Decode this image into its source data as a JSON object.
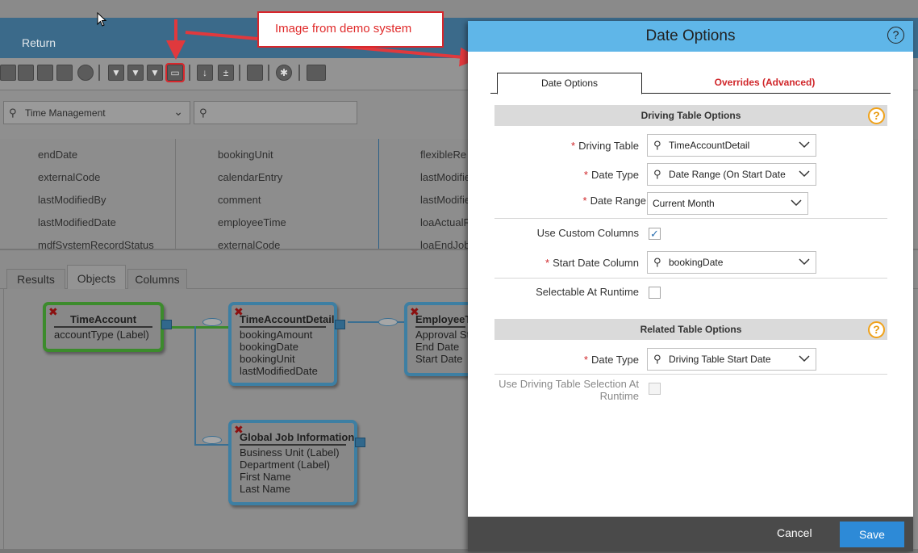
{
  "background": {
    "header": {
      "return_label": "Return"
    },
    "toolbar": {
      "icons": [
        "new-file-icon",
        "open-folder-icon",
        "save-icon",
        "save-as-icon",
        "cancel-icon",
        "filter-icon",
        "filter-settings-icon",
        "filter-help-icon",
        "date-options-icon",
        "sort-az-icon",
        "calculated-column-icon",
        "report-icon",
        "settings-gear-icon",
        "chart-icon"
      ]
    },
    "category_select": {
      "value": "Time Management"
    },
    "search": {
      "placeholder": ""
    },
    "fields": {
      "col1": [
        "endDate",
        "externalCode",
        "lastModifiedBy",
        "lastModifiedDate",
        "mdfSystemRecordStatus"
      ],
      "col2": [
        "bookingUnit",
        "calendarEntry",
        "comment",
        "employeeTime",
        "externalCode"
      ],
      "col3": [
        "flexibleRe",
        "lastModifie",
        "lastModifie",
        "loaActualR",
        "loaEndJob"
      ]
    },
    "tabs": [
      "Results",
      "Objects",
      "Columns"
    ],
    "nodes": {
      "time_account": {
        "title": "TimeAccount",
        "fields": [
          "accountType (Label)"
        ]
      },
      "time_account_detail": {
        "title": "TimeAccountDetail",
        "fields": [
          "bookingAmount",
          "bookingDate",
          "bookingUnit",
          "lastModifiedDate"
        ]
      },
      "employee_time": {
        "title": "EmployeeT",
        "fields": [
          "Approval St",
          "End Date",
          "Start Date"
        ]
      },
      "global_job": {
        "title": "Global Job Information",
        "fields": [
          "Business Unit (Label)",
          "Department (Label)",
          "First Name",
          "Last Name"
        ]
      }
    }
  },
  "annotation": {
    "text": "Image from demo system"
  },
  "dialog": {
    "title": "Date Options",
    "help_icon": "?",
    "tabs": {
      "date_options": "Date Options",
      "overrides": "Overrides (Advanced)"
    },
    "driving_section": {
      "title": "Driving Table Options",
      "driving_table": {
        "label": "Driving Table",
        "value": "TimeAccountDetail"
      },
      "date_type": {
        "label": "Date Type",
        "value": "Date Range (On Start Date"
      },
      "date_range": {
        "label": "Date Range",
        "value": "Current Month"
      },
      "use_custom_columns": {
        "label": "Use Custom Columns",
        "checked": true
      },
      "start_date_column": {
        "label": "Start Date Column",
        "value": "bookingDate"
      },
      "selectable_at_runtime": {
        "label": "Selectable At Runtime",
        "checked": false
      }
    },
    "related_section": {
      "title": "Related Table Options",
      "date_type": {
        "label": "Date Type",
        "value": "Driving Table Start Date"
      },
      "use_driving_selection": {
        "label_line1": "Use Driving Table Selection At",
        "label_line2": "Runtime",
        "checked": false
      }
    },
    "footer": {
      "cancel_label": "Cancel",
      "save_label": "Save"
    }
  },
  "colors": {
    "dialog_header": "#5fb6e8",
    "save_button": "#2d8ad7",
    "required_star": "#d0262a",
    "help_orange": "#f0a21a",
    "annotation_red": "#d8262b"
  }
}
